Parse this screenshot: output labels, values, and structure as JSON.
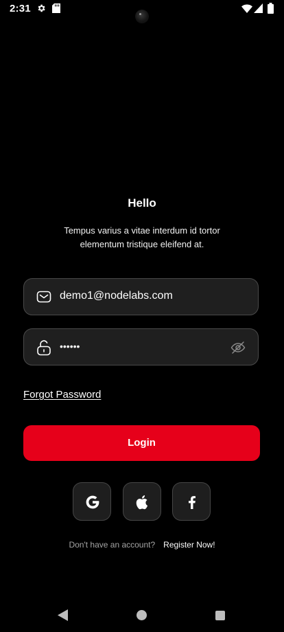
{
  "status_bar": {
    "time": "2:31",
    "left_icons": [
      "gear-icon",
      "sd-card-icon"
    ],
    "right_icons": [
      "wifi-icon",
      "signal-icon",
      "battery-icon"
    ]
  },
  "header": {
    "title": "Hello",
    "subtitle": "Tempus varius a vitae interdum id tortor elementum tristique eleifend at."
  },
  "email_field": {
    "value": "demo1@nodelabs.com",
    "icon": "mail-icon"
  },
  "password_field": {
    "value": "••••••",
    "icon": "unlock-icon",
    "toggle_icon": "eye-off-icon"
  },
  "forgot_password": "Forgot Password",
  "login_button": "Login",
  "social_buttons": [
    {
      "icon": "google-icon"
    },
    {
      "icon": "apple-icon"
    },
    {
      "icon": "facebook-icon"
    }
  ],
  "register": {
    "prompt": "Don't have an account?",
    "link": "Register Now!"
  },
  "navigation_bar": {
    "icons": [
      "back-icon",
      "home-icon",
      "recents-icon"
    ]
  },
  "colors": {
    "background": "#000000",
    "accent": "#e6001a",
    "field_background": "#1f1f1f",
    "field_border": "#4a4a4a"
  }
}
